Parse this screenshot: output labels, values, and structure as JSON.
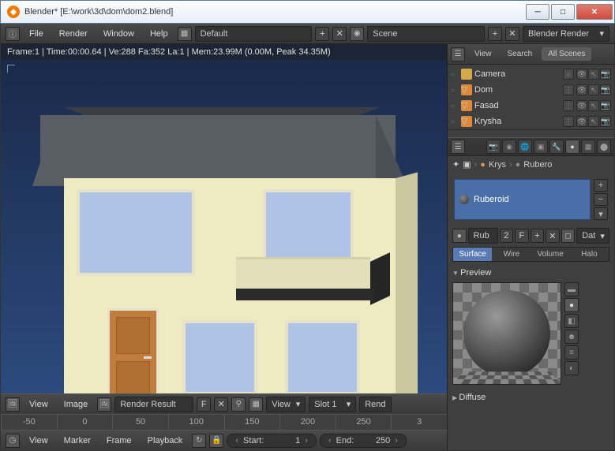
{
  "window": {
    "title": "Blender* [E:\\work\\3d\\dom\\dom2.blend]"
  },
  "topmenu": {
    "file": "File",
    "render": "Render",
    "window": "Window",
    "help": "Help"
  },
  "topbar": {
    "layout": "Default",
    "scene": "Scene",
    "engine": "Blender Render"
  },
  "infoline": "Frame:1 | Time:00:00.64 | Ve:288 Fa:352 La:1 | Mem:23.99M (0.00M, Peak 34.35M)",
  "imgbar": {
    "view": "View",
    "image": "Image",
    "slot_dd": "Render Result",
    "f": "F",
    "view2": "View",
    "slot": "Slot 1",
    "rend": "Rend"
  },
  "ruler": [
    "-50",
    "0",
    "50",
    "100",
    "150",
    "200",
    "250",
    "3"
  ],
  "timeline": {
    "view": "View",
    "marker": "Marker",
    "frame": "Frame",
    "playback": "Playback",
    "start_l": "Start:",
    "start_v": "1",
    "end_l": "End:",
    "end_v": "250"
  },
  "outliner": {
    "view": "View",
    "search": "Search",
    "tab": "All Scenes",
    "items": [
      {
        "name": "Camera",
        "icon": "cam"
      },
      {
        "name": "Dom",
        "icon": "obj"
      },
      {
        "name": "Fasad",
        "icon": "obj"
      },
      {
        "name": "Krysha",
        "icon": "obj"
      }
    ]
  },
  "breadcrumb": {
    "a": "Krys",
    "b": "Rubero"
  },
  "material": {
    "name": "Ruberoid",
    "id": "Rub",
    "users": "2",
    "f": "F",
    "dd": "Dat"
  },
  "shading_tabs": {
    "surface": "Surface",
    "wire": "Wire",
    "volume": "Volume",
    "halo": "Halo"
  },
  "panels": {
    "preview": "Preview",
    "diffuse": "Diffuse"
  }
}
